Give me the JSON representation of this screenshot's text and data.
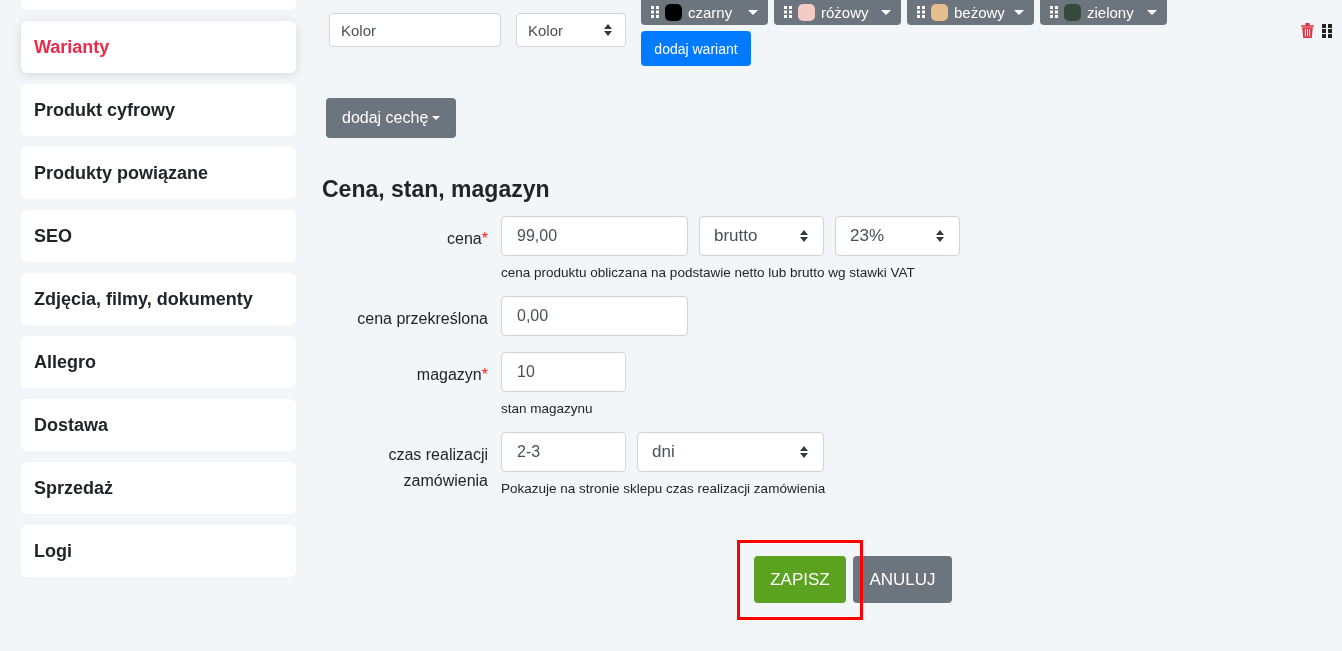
{
  "sidebar": {
    "items": [
      {
        "selected": false
      },
      {
        "label": "Warianty",
        "selected": true
      },
      {
        "label": "Produkt cyfrowy",
        "selected": false
      },
      {
        "label": "Produkty powiązane",
        "selected": false
      },
      {
        "label": "SEO",
        "selected": false
      },
      {
        "label": "Zdjęcia, filmy, dokumenty",
        "selected": false
      },
      {
        "label": "Allegro",
        "selected": false
      },
      {
        "label": "Dostawa",
        "selected": false
      },
      {
        "label": "Sprzedaż",
        "selected": false
      },
      {
        "label": "Logi",
        "selected": false
      }
    ]
  },
  "variants": {
    "name_value": "Kolor",
    "type_select": "Kolor",
    "values": [
      {
        "name": "czarny",
        "color": "#000000"
      },
      {
        "name": "różowy",
        "color": "#f2cbc4"
      },
      {
        "name": "beżowy",
        "color": "#e6bd8e"
      },
      {
        "name": "zielony",
        "color": "#334a3d"
      }
    ],
    "add_variant": "dodaj wariant"
  },
  "add_feature": "dodaj cechę",
  "section": {
    "title": "Cena, stan, magazyn",
    "required_mark": "*",
    "fields": [
      {
        "label": "cena",
        "required": true,
        "value": "99,00",
        "selects": [
          "brutto",
          "23%"
        ],
        "help": "cena produktu obliczana na podstawie netto lub brutto wg stawki VAT"
      },
      {
        "label": "cena przekreślona",
        "required": false,
        "value": "0,00"
      },
      {
        "label": "magazyn",
        "required": true,
        "value": "10",
        "help": "stan magazynu",
        "narrow": true
      },
      {
        "label": "czas realizacji zamówienia",
        "required": false,
        "value": "2-3",
        "selects": [
          "dni"
        ],
        "help": "Pokazuje na stronie sklepu czas realizacji zamówienia",
        "narrow": true
      }
    ]
  },
  "buttons": {
    "save": "ZAPISZ",
    "cancel": "ANULUJ"
  }
}
